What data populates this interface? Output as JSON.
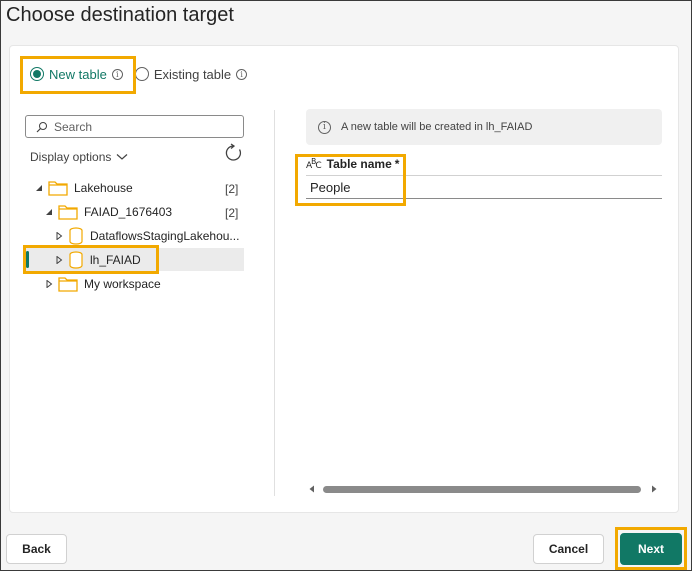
{
  "dialog": {
    "title": "Choose destination target"
  },
  "destination_mode": {
    "options": [
      {
        "label": "New table",
        "selected": true
      },
      {
        "label": "Existing table",
        "selected": false
      }
    ]
  },
  "navigator": {
    "search_placeholder": "Search",
    "display_options_label": "Display options",
    "tree": [
      {
        "label": "Lakehouse",
        "count": "[2]",
        "expanded": true,
        "icon": "folder-icon"
      },
      {
        "label": "FAIAD_1676403",
        "count": "[2]",
        "expanded": true,
        "icon": "folder-icon"
      },
      {
        "label": "DataflowsStagingLakehou...",
        "expanded": false,
        "icon": "lakehouse-icon"
      },
      {
        "label": "lh_FAIAD",
        "expanded": false,
        "selected": true,
        "icon": "lakehouse-icon"
      },
      {
        "label": "My workspace",
        "expanded": false,
        "icon": "folder-icon"
      }
    ]
  },
  "details": {
    "info_message": "A new table will be created in lh_FAIAD",
    "table_name_label": "Table name",
    "required_marker": "*",
    "table_name_value": "People",
    "field_type_icon": "abc-icon"
  },
  "footer": {
    "back_label": "Back",
    "cancel_label": "Cancel",
    "next_label": "Next"
  },
  "colors": {
    "accent": "#117865",
    "highlight": "#f2a900",
    "folder": "#f2a900"
  }
}
